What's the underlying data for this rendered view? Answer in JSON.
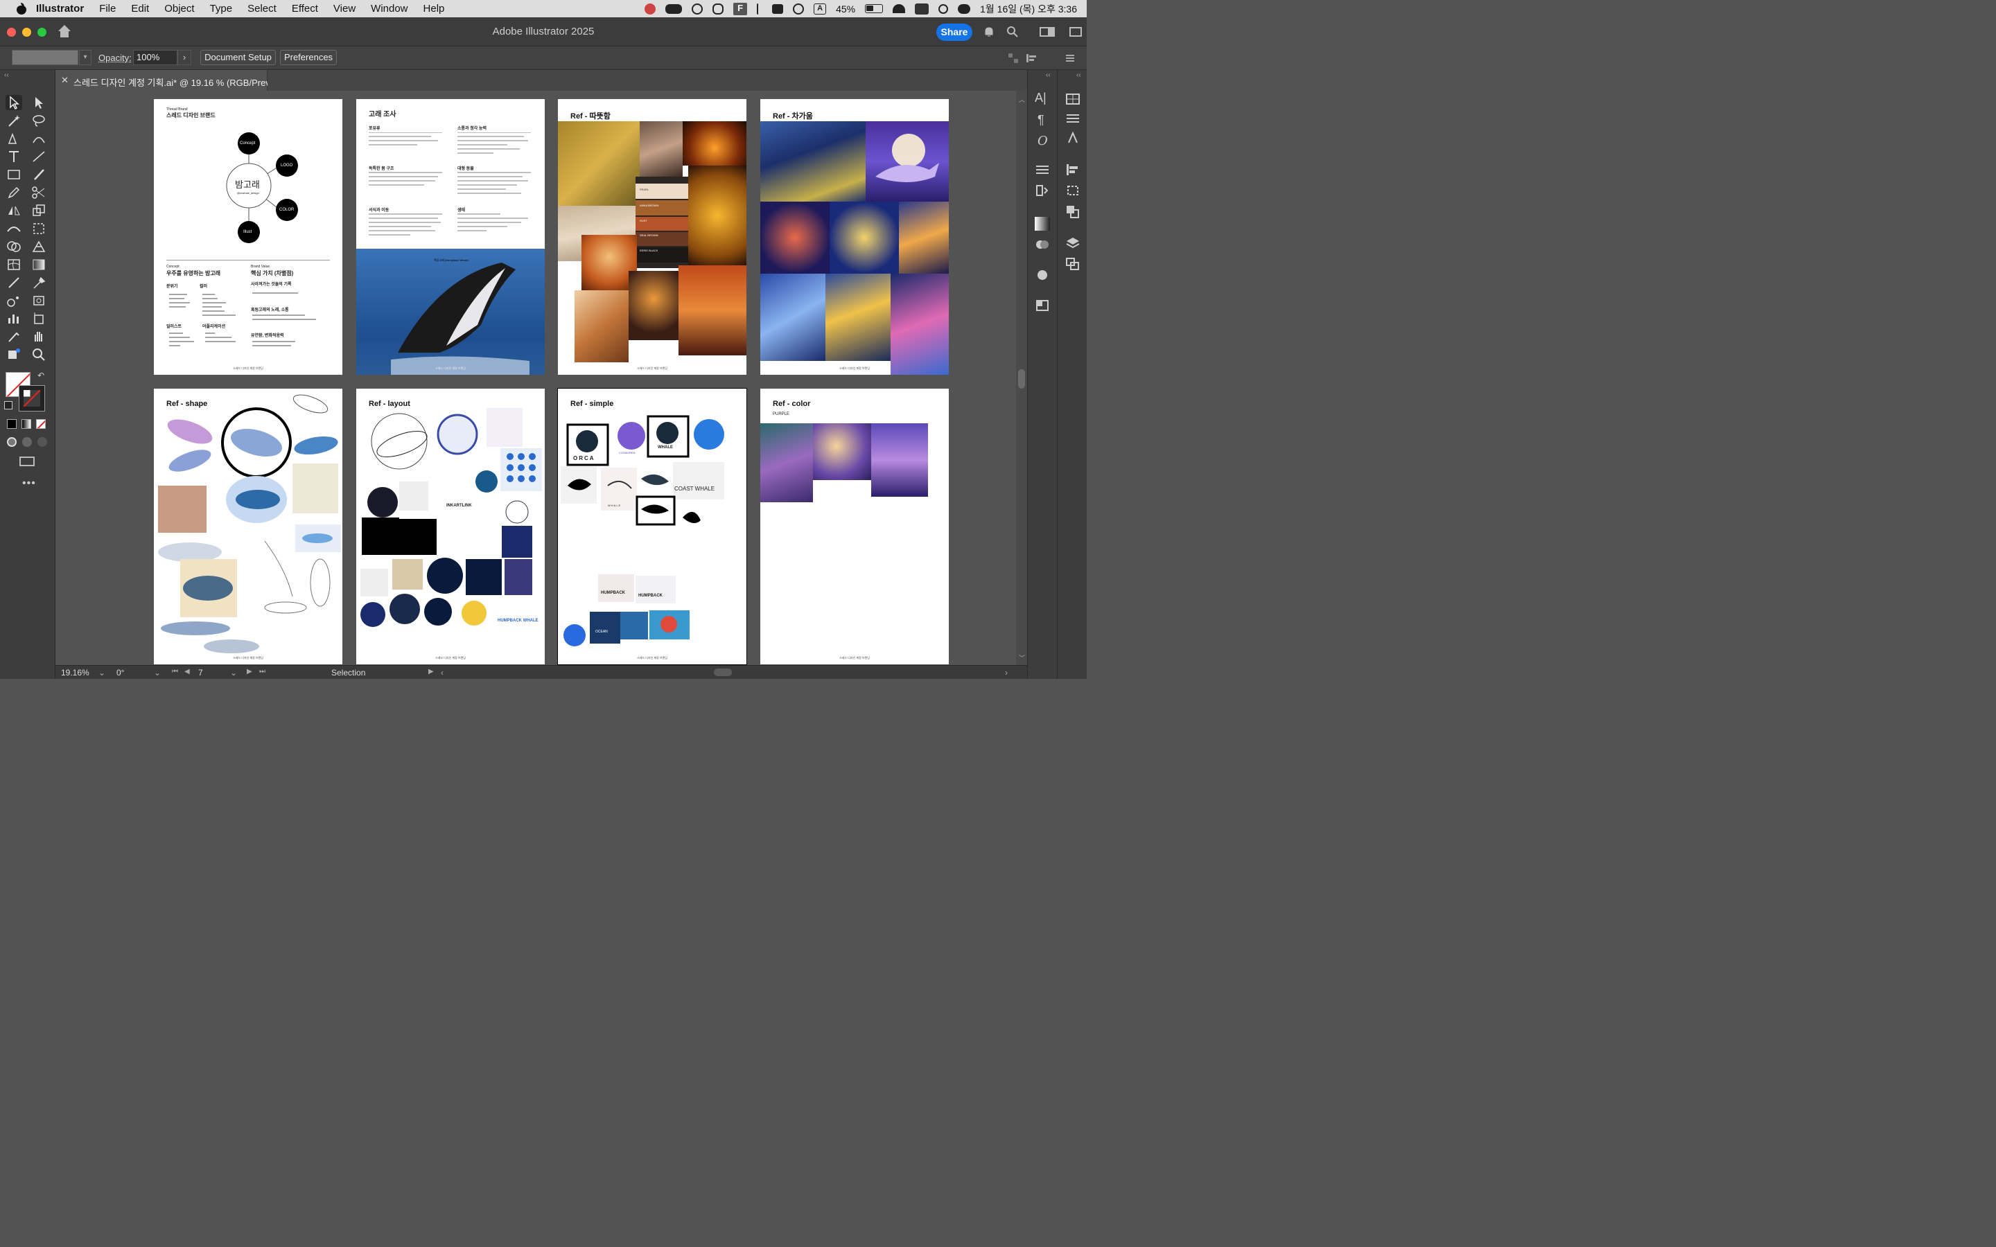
{
  "menubar": {
    "app_name": "Illustrator",
    "items": [
      "File",
      "Edit",
      "Object",
      "Type",
      "Select",
      "Effect",
      "View",
      "Window",
      "Help"
    ],
    "battery": "45%",
    "datetime": "1월 16일 (목) 오후 3:36"
  },
  "titlebar": {
    "title": "Adobe Illustrator 2025",
    "share_label": "Share"
  },
  "controlbar": {
    "opacity_label": "Opacity:",
    "opacity_value": "100%",
    "document_setup": "Document Setup",
    "preferences": "Preferences"
  },
  "document": {
    "tab_title": "스레드 디자인 계정 기획.ai* @ 19.16 % (RGB/Preview)"
  },
  "artboards": {
    "a1": {
      "label": "Thread Brand",
      "title": "스레드 디자인 브랜드",
      "center_title": "밤고래",
      "center_handle": "@mwhale_design",
      "nodes": [
        "Concept",
        "LOGO",
        "COLOR",
        "Illust"
      ],
      "concept_label": "Concept",
      "concept_title": "우주를 유영하는 밤고래",
      "value_label": "Brand Value",
      "value_title": "핵심 가치 (차별점)",
      "col1": "분위기",
      "col2": "컬러",
      "col3": "일러스트",
      "col4": "어플리케이션",
      "v1": "사라져가는 것들의 기록",
      "v2": "혹등고래의 노래, 소통",
      "v3": "유연함, 변화적응력"
    },
    "a2": {
      "title": "고래 조사",
      "h1": "포유류",
      "h2": "소통과 청각 능력",
      "h3": "독특한 몸 구조",
      "h4": "대형 동물",
      "h5": "서식과 이동",
      "h6": "생태",
      "caption": "혹등고래 (Humpback Whale)"
    },
    "a3": {
      "title": "Ref - 따뜻함",
      "swatches": [
        "PEARL",
        "ANNA BROWN",
        "RUST",
        "SEAL BROWN",
        "EERIE BLACK"
      ]
    },
    "a4": {
      "title": "Ref - 차가움"
    },
    "a5": {
      "title": "Ref - shape"
    },
    "a6": {
      "title": "Ref - layout",
      "inkart": "INKARTLINK",
      "humpback": "HUMPBACK WHALE"
    },
    "a7": {
      "title": "Ref - simple",
      "orca": "ORCA",
      "cosmoren": "COSMOREN",
      "whale": "WHALE",
      "coast": "COAST WHALE",
      "whale2": "WHALE",
      "humpback": "HUMPBACK",
      "humpback2": "HUMPBACK",
      "ocean": "OCEAN"
    },
    "a8": {
      "title": "Ref - color",
      "subtitle": "PURPLE"
    },
    "footer": "스레드 디자인 계정 브랜딩"
  },
  "statusbar": {
    "zoom": "19.16%",
    "rotation": "0°",
    "artboard_number": "7",
    "tool_status": "Selection"
  },
  "colors": {
    "accent": "#1473e6",
    "ui_dark": "#3d3d3d",
    "canvas": "#535353"
  }
}
